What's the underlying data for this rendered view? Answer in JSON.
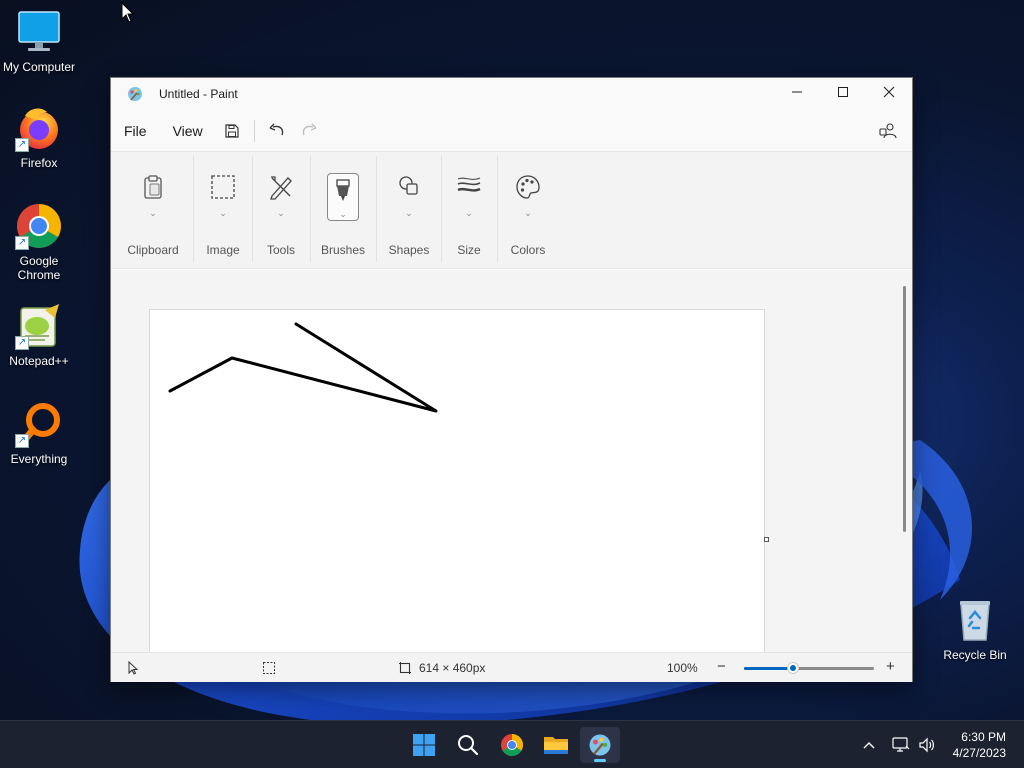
{
  "desktop": {
    "icons": [
      {
        "label": "My Computer",
        "icon": "monitor-icon",
        "shortcut": false
      },
      {
        "label": "Firefox",
        "icon": "firefox-icon",
        "shortcut": true
      },
      {
        "label": "Google Chrome",
        "icon": "chrome-icon",
        "shortcut": true
      },
      {
        "label": "Notepad++",
        "icon": "notepadpp-icon",
        "shortcut": true
      },
      {
        "label": "Everything",
        "icon": "everything-search-icon",
        "shortcut": true
      },
      {
        "label": "Recycle Bin",
        "icon": "recycle-bin-icon",
        "shortcut": false
      }
    ],
    "shortcut_arrow": "↗"
  },
  "window": {
    "title": "Untitled - Paint",
    "minimize": "—",
    "close": "✕"
  },
  "menu": {
    "file": "File",
    "view": "View"
  },
  "ribbon": {
    "groups": [
      {
        "label": "Clipboard",
        "icon": "clipboard-icon"
      },
      {
        "label": "Image",
        "icon": "selection-icon"
      },
      {
        "label": "Tools",
        "icon": "pencil-tools-icon"
      },
      {
        "label": "Brushes",
        "icon": "brush-icon",
        "selected": true
      },
      {
        "label": "Shapes",
        "icon": "shapes-icon"
      },
      {
        "label": "Size",
        "icon": "line-size-icon"
      },
      {
        "label": "Colors",
        "icon": "palette-icon"
      }
    ],
    "chevron": "⌄"
  },
  "canvas": {
    "stroke_color": "#000000"
  },
  "status": {
    "canvas_size": "614 × 460px",
    "zoom": "100%",
    "zoom_out": "−",
    "zoom_in": "+",
    "zoom_level_fraction": 0.38
  },
  "taskbar": {
    "apps": [
      "start-icon",
      "search-icon",
      "chrome-icon",
      "file-explorer-icon",
      "paint-icon"
    ],
    "active_app": "paint-icon",
    "time": "6:30 PM",
    "date": "4/27/2023"
  },
  "colors": {
    "accent": "#0067c0",
    "taskbar_indicator": "#60cdff"
  }
}
